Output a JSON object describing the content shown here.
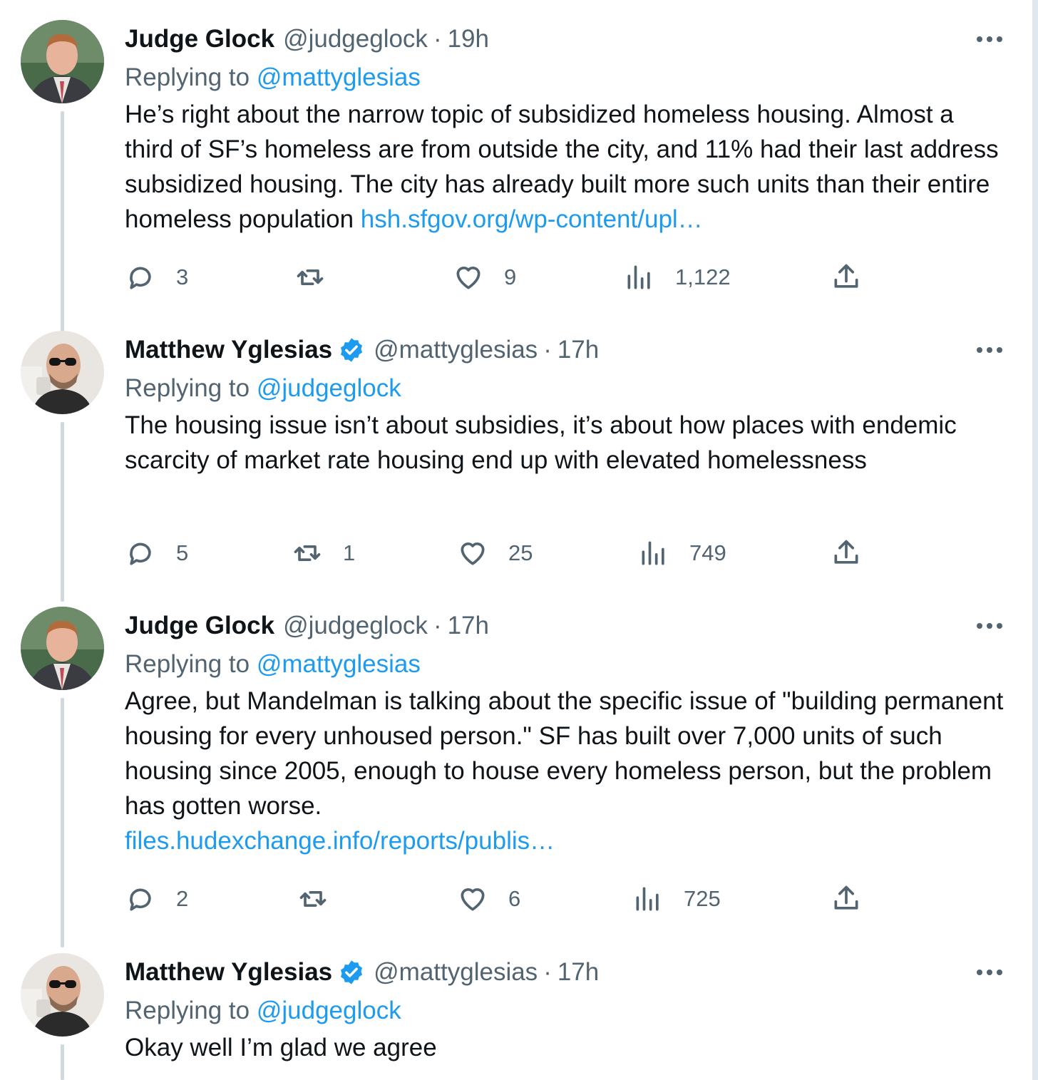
{
  "tweets": [
    {
      "name": "Judge Glock",
      "handle": "@judgeglock",
      "separator": "·",
      "time": "19h",
      "verified": false,
      "replying_label": "Replying to",
      "replying_to": "@mattyglesias",
      "text": "He’s right about the narrow topic of subsidized homeless housing. Almost a third of SF’s homeless are from outside the city, and 11% had their last address subsidized housing. The city has already built more such units than their entire homeless population",
      "link": "hsh.sfgov.org/wp-content/upl…",
      "replies": "3",
      "retweets": "",
      "likes": "9",
      "views": "1,122"
    },
    {
      "name": "Matthew Yglesias",
      "handle": "@mattyglesias",
      "separator": "·",
      "time": "17h",
      "verified": true,
      "replying_label": "Replying to",
      "replying_to": "@judgeglock",
      "text": "The housing issue isn’t about subsidies, it’s about how places with endemic scarcity of market rate housing end up with elevated homelessness",
      "link": "",
      "replies": "5",
      "retweets": "1",
      "likes": "25",
      "views": "749"
    },
    {
      "name": "Judge Glock",
      "handle": "@judgeglock",
      "separator": "·",
      "time": "17h",
      "verified": false,
      "replying_label": "Replying to",
      "replying_to": "@mattyglesias",
      "text": "Agree, but Mandelman is talking about the specific issue of \"building permanent housing for every unhoused person.\" SF has built over 7,000 units of such housing since 2005, enough to house every homeless person, but the problem has gotten worse.",
      "link": "files.hudexchange.info/reports/publis…",
      "replies": "2",
      "retweets": "",
      "likes": "6",
      "views": "725"
    },
    {
      "name": "Matthew Yglesias",
      "handle": "@mattyglesias",
      "separator": "·",
      "time": "17h",
      "verified": true,
      "replying_label": "Replying to",
      "replying_to": "@judgeglock",
      "text": "Okay well I’m glad we agree",
      "link": ""
    }
  ],
  "colors": {
    "text": "#0f1419",
    "secondary": "#536471",
    "link": "#1d9bf0",
    "verified": "#1d9bf0",
    "thread_line": "#cfd9de"
  },
  "icons": [
    "reply-icon",
    "retweet-icon",
    "like-icon",
    "views-icon",
    "share-icon",
    "more-icon",
    "verified-badge-icon"
  ]
}
